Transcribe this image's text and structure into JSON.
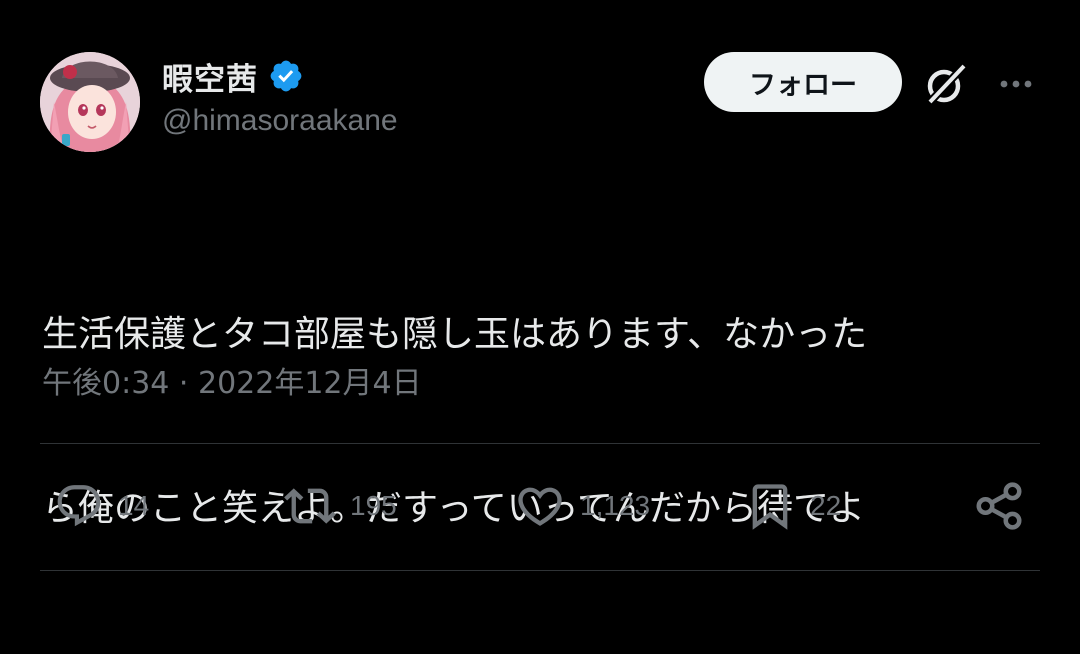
{
  "user": {
    "display_name": "暇空茜",
    "handle": "@himasoraakane",
    "verified": true
  },
  "header": {
    "follow_label": "フォロー",
    "grok_icon": "grok-icon",
    "more_icon": "more-icon"
  },
  "tweet": {
    "text_line1": "生活保護とタコ部屋も隠し玉はあります、なかった",
    "text_line2": "ら俺のこと笑えよ。だすっていってんだから待てよ",
    "timestamp": "午後0:34 · 2022年12月4日"
  },
  "actions": {
    "reply_count": "14",
    "repost_count": "195",
    "like_count": "1,123",
    "bookmark_count": "22"
  },
  "colors": {
    "background": "#000000",
    "text": "#e7e9ea",
    "secondary": "#71767b",
    "verified": "#1d9bf0",
    "follow_bg": "#eff3f4",
    "divider": "#2f3336"
  }
}
